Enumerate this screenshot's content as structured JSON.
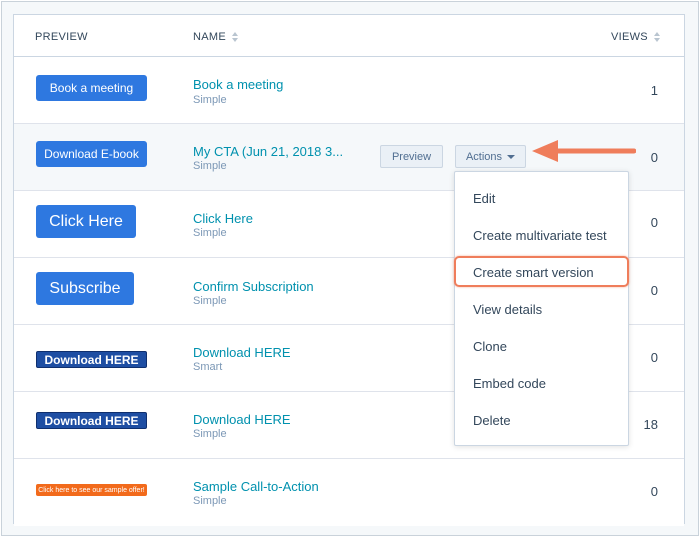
{
  "header": {
    "preview": "PREVIEW",
    "name": "NAME",
    "views": "VIEWS"
  },
  "rows": [
    {
      "preview_label": "Book a meeting",
      "preview_style": "blue",
      "name": "Book a meeting",
      "type": "Simple",
      "views": "1"
    },
    {
      "preview_label": "Download E-book",
      "preview_style": "blue",
      "name": "My CTA (Jun 21, 2018 3...",
      "type": "Simple",
      "views": "0"
    },
    {
      "preview_label": "Click Here",
      "preview_style": "blue",
      "name": "Click Here",
      "type": "Simple",
      "views": "0"
    },
    {
      "preview_label": "Subscribe",
      "preview_style": "blue",
      "name": "Confirm Subscription",
      "type": "Simple",
      "views": "0"
    },
    {
      "preview_label": "Download HERE",
      "preview_style": "dark",
      "name": "Download HERE",
      "type": "Smart",
      "views": "0"
    },
    {
      "preview_label": "Download HERE",
      "preview_style": "dark",
      "name": "Download HERE",
      "type": "Simple",
      "views": "18"
    },
    {
      "preview_label": "Click here to see our sample offer!",
      "preview_style": "orange",
      "name": "Sample Call-to-Action",
      "type": "Simple",
      "views": "0"
    }
  ],
  "row_actions": {
    "preview_label": "Preview",
    "actions_label": "Actions"
  },
  "actions_menu": {
    "items": [
      "Edit",
      "Create multivariate test",
      "Create smart version",
      "View details",
      "Clone",
      "Embed code",
      "Delete"
    ],
    "highlighted": "Create smart version"
  },
  "colors": {
    "link": "#0091ae",
    "cta_blue": "#2e78e0",
    "cta_dark": "#1e4ea3",
    "cta_orange": "#f26a1b",
    "annotation": "#ef7d5b"
  }
}
